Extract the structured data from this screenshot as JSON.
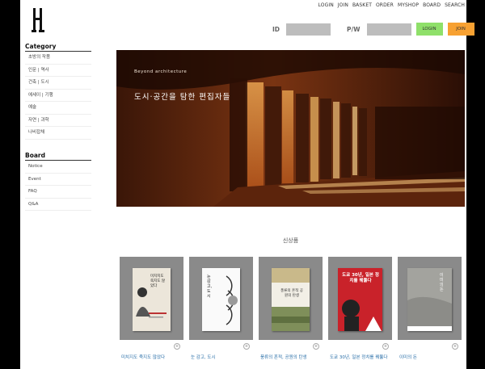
{
  "topnav": [
    "LOGIN",
    "JOIN",
    "BASKET",
    "ORDER",
    "MYSHOP",
    "BOARD",
    "SEARCH"
  ],
  "login": {
    "id_label": "ID",
    "pw_label": "P/W",
    "login_button": "LOGIN",
    "join_button": "JOIN"
  },
  "category": {
    "title": "Category",
    "items": [
      "초방의 작품",
      "인문 | 역사",
      "건축 | 도시",
      "에세이 | 기행",
      "예술",
      "자연 | 과학",
      "나비잡채"
    ]
  },
  "board": {
    "title": "Board",
    "items": [
      "Notice",
      "Event",
      "FAQ",
      "Q&A"
    ]
  },
  "hero": {
    "small_text": "Beyond architecture",
    "headline": "도시·공간을 탐한 편집자들"
  },
  "section_title": "신상품",
  "products": [
    {
      "name": "미치지도 죽지도 않았다",
      "cover_title": "미치지도 죽지도 않았다"
    },
    {
      "name": "눈 감고, 도시",
      "cover_title": "눈 감고, 도시"
    },
    {
      "name": "풍류의 흔적, 공원의 탄생",
      "cover_title": "풍류의 흔적 공원의 탄생"
    },
    {
      "name": "도쿄 30년, 일본 정치를 꿰뚫다",
      "cover_title": "도쿄 30년, 일본 정치를 꿰뚫다"
    },
    {
      "name": "이미의 돈",
      "cover_title": "이미의 돈"
    }
  ],
  "colors": {
    "login_button": "#8fe06a",
    "join_button": "#f7a132",
    "link": "#2a6fa8",
    "card_bg": "#8a8a8a"
  }
}
